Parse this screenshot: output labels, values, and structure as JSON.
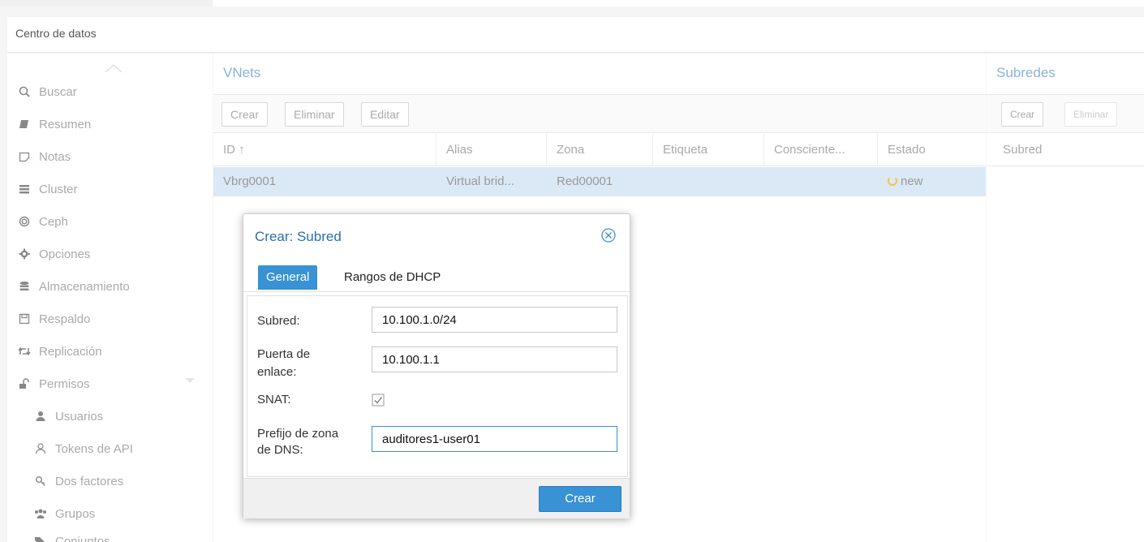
{
  "header": {
    "title": "Centro de datos"
  },
  "sidebar": {
    "items": [
      {
        "label": "Buscar",
        "icon": "search-icon"
      },
      {
        "label": "Resumen",
        "icon": "book-icon"
      },
      {
        "label": "Notas",
        "icon": "note-icon"
      },
      {
        "label": "Cluster",
        "icon": "server-icon"
      },
      {
        "label": "Ceph",
        "icon": "ceph-icon"
      },
      {
        "label": "Opciones",
        "icon": "gear-icon"
      },
      {
        "label": "Almacenamiento",
        "icon": "database-icon"
      },
      {
        "label": "Respaldo",
        "icon": "floppy-icon"
      },
      {
        "label": "Replicación",
        "icon": "retweet-icon"
      },
      {
        "label": "Permisos",
        "icon": "unlock-icon"
      },
      {
        "label": "Usuarios",
        "icon": "user-icon"
      },
      {
        "label": "Tokens de API",
        "icon": "user-outline-icon"
      },
      {
        "label": "Dos factores",
        "icon": "key-icon"
      },
      {
        "label": "Grupos",
        "icon": "users-icon"
      },
      {
        "label": "Conjuntos",
        "icon": "tags-icon"
      }
    ]
  },
  "vnets": {
    "title": "VNets",
    "toolbar": {
      "create": "Crear",
      "delete": "Eliminar",
      "edit": "Editar"
    },
    "columns": [
      "ID ↑",
      "Alias",
      "Zona",
      "Etiqueta",
      "Consciente...",
      "Estado"
    ],
    "rows": [
      {
        "id": "Vbrg0001",
        "alias": "Virtual brid...",
        "zone": "Red00001",
        "tag": "",
        "aware": "",
        "state": "new"
      }
    ]
  },
  "subnets": {
    "title": "Subredes",
    "toolbar": {
      "create": "Crear",
      "delete": "Eliminar"
    },
    "columns": [
      "Subred"
    ]
  },
  "dialog": {
    "title": "Crear: Subred",
    "tabs": [
      "General",
      "Rangos de DHCP"
    ],
    "fields": {
      "subnet_label": "Subred:",
      "subnet_value": "10.100.1.0/24",
      "gateway_label_1": "Puerta de",
      "gateway_label_2": "enlace:",
      "gateway_value": "10.100.1.1",
      "snat_label": "SNAT:",
      "snat_checked": true,
      "dns_label_1": "Prefijo de zona",
      "dns_label_2": "de DNS:",
      "dns_value": "auditores1-user01"
    },
    "submit": "Crear"
  },
  "colors": {
    "accent": "#3892d4",
    "selected_row": "#dbe9f6",
    "status_pending": "#f5c542"
  }
}
